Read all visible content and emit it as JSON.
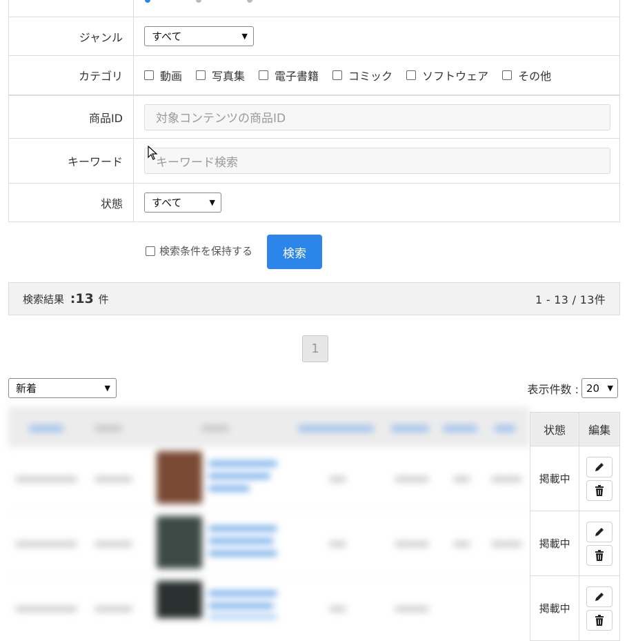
{
  "form": {
    "genre": {
      "label": "ジャンル",
      "selected": "すべて"
    },
    "category": {
      "label": "カテゴリ",
      "options": [
        "動画",
        "写真集",
        "電子書籍",
        "コミック",
        "ソフトウェア",
        "その他"
      ]
    },
    "product_id": {
      "label": "商品ID",
      "placeholder": "対象コンテンツの商品ID"
    },
    "keyword": {
      "label": "キーワード",
      "placeholder": "キーワード検索"
    },
    "status": {
      "label": "状態",
      "selected": "すべて"
    }
  },
  "search": {
    "keep_label": "検索条件を保持する",
    "button_label": "検索"
  },
  "results": {
    "label": "検索結果",
    "colon": ":",
    "count": "13",
    "unit": "件",
    "range": "1 - 13 / 13件"
  },
  "pagination": {
    "current": "1"
  },
  "sort": {
    "selected": "新着"
  },
  "per_page": {
    "label": "表示件数 :",
    "selected": "20"
  },
  "table": {
    "headers": {
      "status": "状態",
      "edit": "編集"
    },
    "rows": [
      {
        "status": "掲載中"
      },
      {
        "status": "掲載中"
      },
      {
        "status": "掲載中"
      }
    ]
  },
  "colors": {
    "accent": "#2c86ea",
    "border": "#dcdcdc",
    "header_bg": "#ececec",
    "result_bg": "#f2f2f2"
  }
}
